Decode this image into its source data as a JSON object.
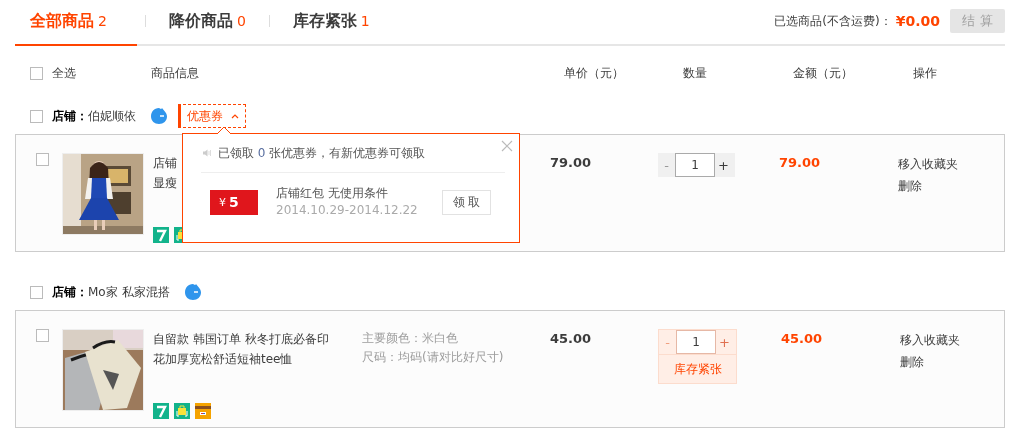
{
  "tabs": [
    {
      "label": "全部商品",
      "count": "2",
      "selected": true
    },
    {
      "label": "降价商品",
      "count": "0",
      "selected": false
    },
    {
      "label": "库存紧张",
      "count": "1",
      "selected": false
    }
  ],
  "summary": {
    "label": "已选商品(不含运费)：",
    "total": "¥0.00",
    "checkout": "结 算",
    "checkout_disabled": true
  },
  "header": {
    "select_all": {
      "label": "全选",
      "checked": false
    },
    "columns": [
      "商品信息",
      "单价（元）",
      "数量",
      "金额（元）",
      "操作"
    ]
  },
  "shops": [
    {
      "label": "店铺：",
      "name": "伯妮顺依",
      "checked": false,
      "coupon": {
        "label": "优惠券",
        "expanded": true
      },
      "items": [
        {
          "checked": false,
          "title": [
            "店铺",
            "显瘦"
          ],
          "price": "79.00",
          "minus": "-",
          "quantity": "1",
          "plus": "+",
          "minus_disabled": true,
          "amount": "79.00",
          "actions": [
            "移入收藏夹",
            "删除"
          ],
          "badges": [
            {
              "kind": "seven"
            },
            {
              "kind": "bag"
            }
          ]
        }
      ]
    },
    {
      "label": "店铺：",
      "name": "Mo家 私家混搭",
      "checked": false,
      "items": [
        {
          "checked": false,
          "title": [
            "自留款 韩国订单 秋冬打底必备印",
            "花加厚宽松舒适短袖tee恤"
          ],
          "props": [
            "主要颜色：米白色",
            "尺码：均码(请对比好尺寸)"
          ],
          "price": "45.00",
          "minus": "-",
          "quantity": "1",
          "plus": "+",
          "minus_disabled": true,
          "stock_note": "库存紧张",
          "amount": "45.00",
          "actions": [
            "移入收藏夹",
            "删除"
          ],
          "badges": [
            {
              "kind": "seven"
            },
            {
              "kind": "bag"
            },
            {
              "kind": "card"
            }
          ]
        }
      ]
    }
  ],
  "coupon_popup": {
    "notice_prefix": "已领取",
    "claimed_count": "0",
    "notice_suffix": "张优惠券，有新优惠券可领取",
    "coupons": [
      {
        "currency": "¥",
        "value": "5",
        "name": "店铺红包 无使用条件",
        "validity": "2014.10.29-2014.12.22",
        "button": "领 取"
      }
    ]
  }
}
